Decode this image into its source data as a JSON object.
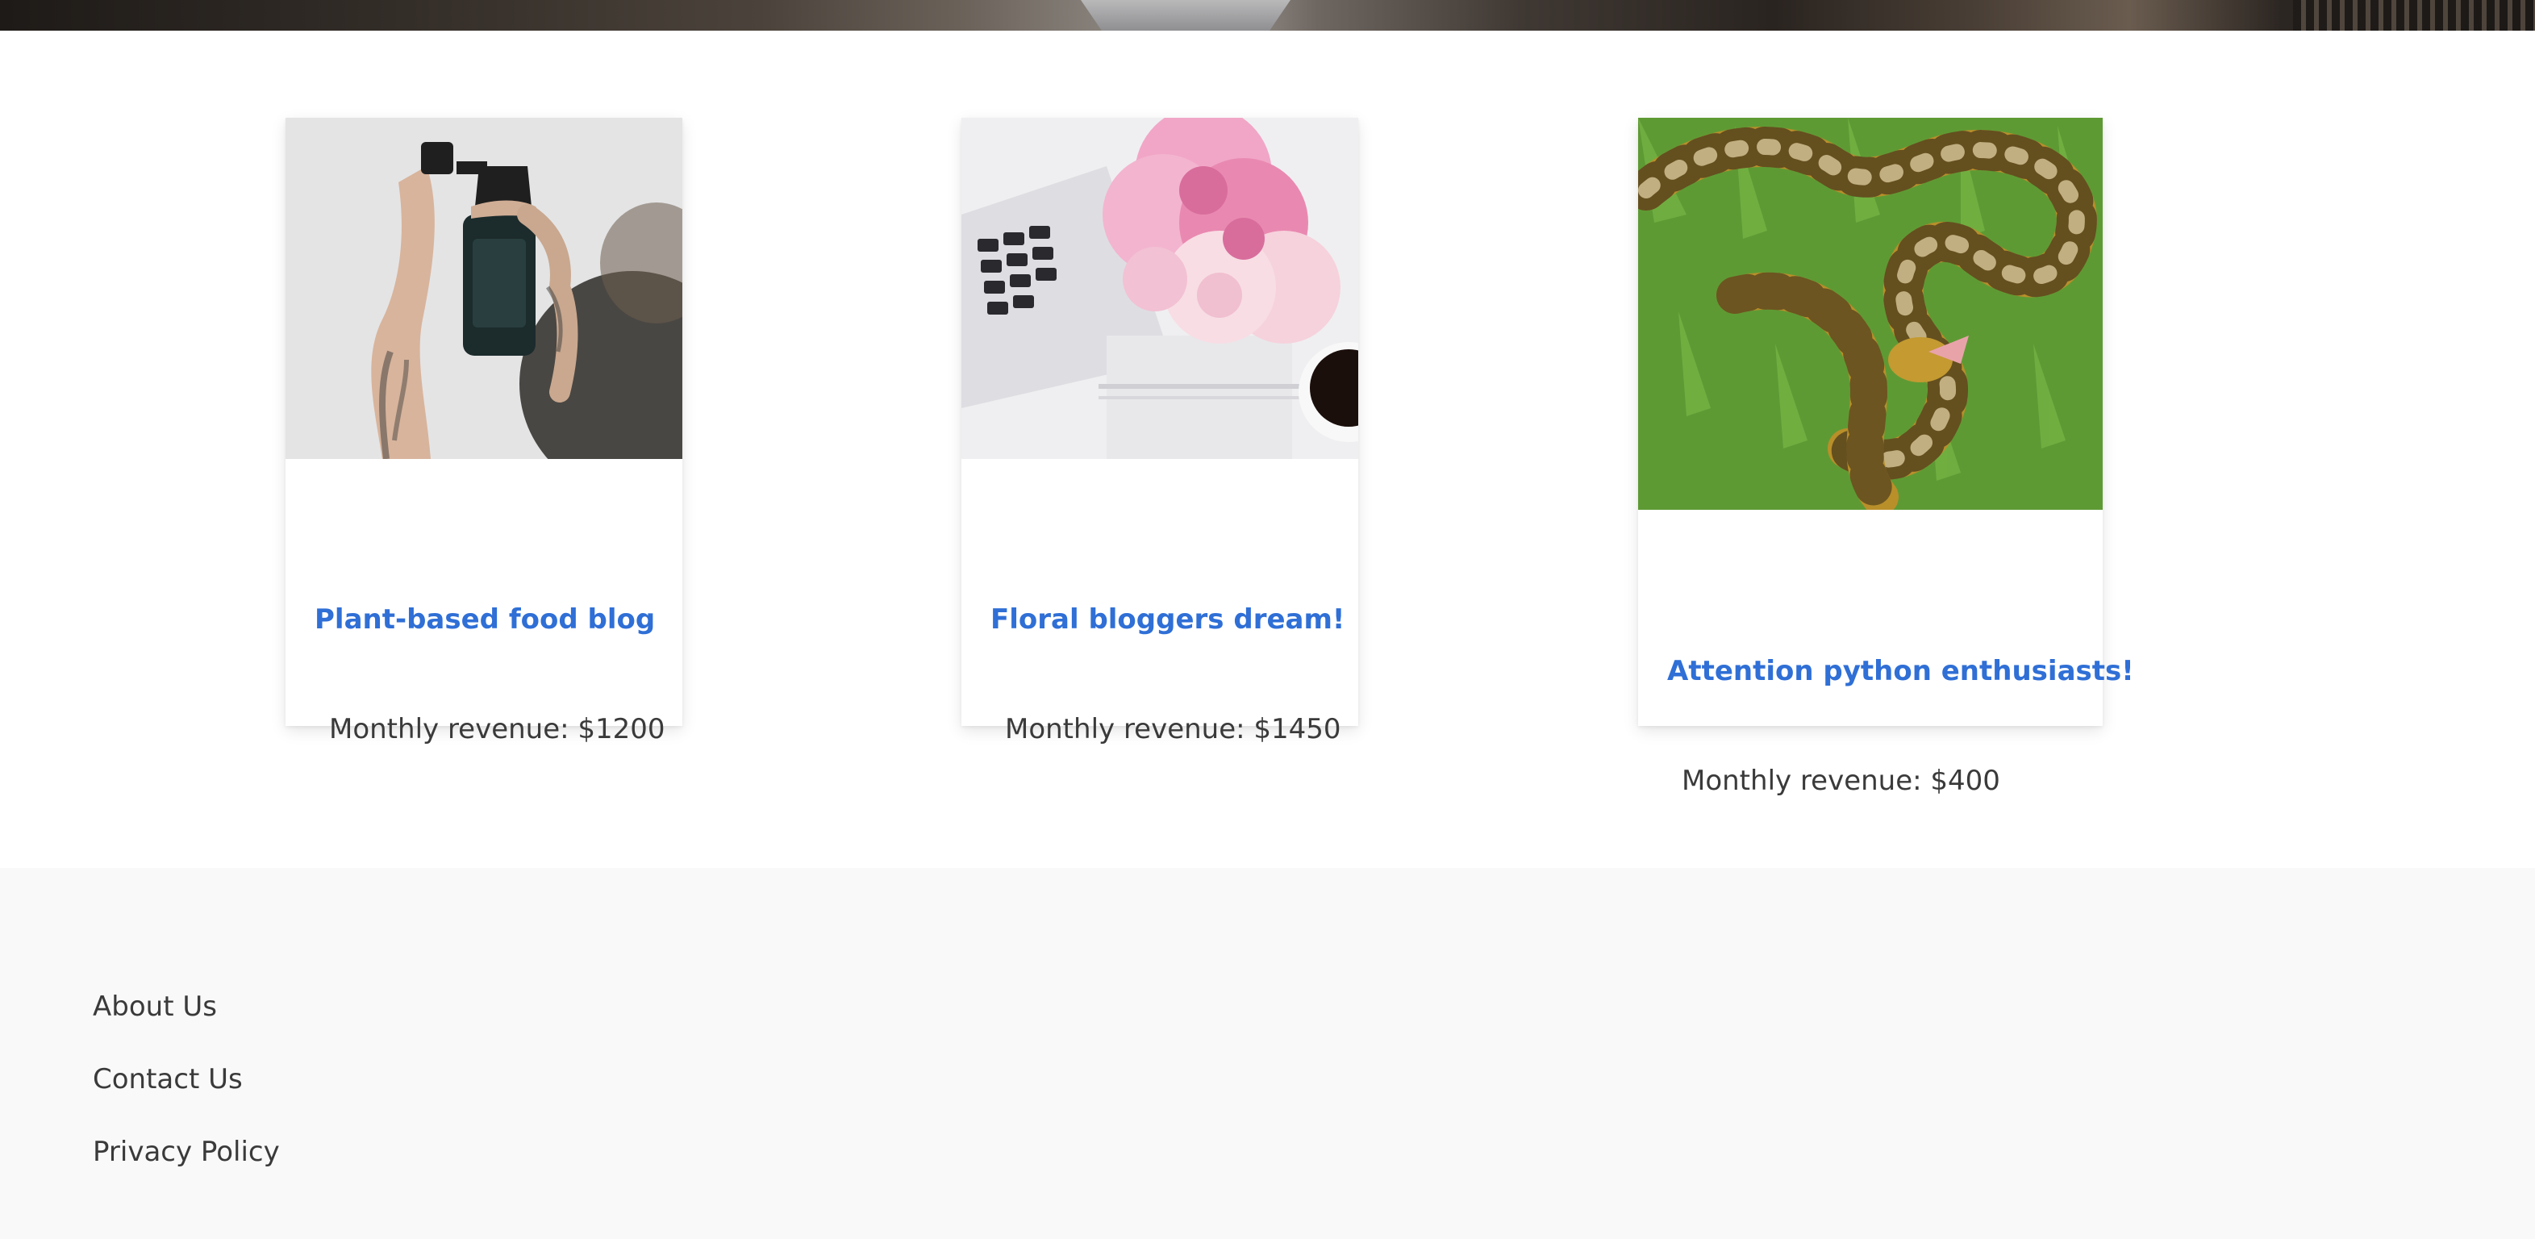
{
  "colors": {
    "link_blue": "#2f6fd6",
    "text": "#3a3a3a",
    "footer_bg": "#f9f9f9"
  },
  "listings": [
    {
      "title": "Plant-based food blog",
      "revenue": "Monthly revenue: $1200",
      "image_icon": "hand-spray-bottle-image"
    },
    {
      "title": "Floral bloggers dream!",
      "revenue": "Monthly revenue: $1450",
      "image_icon": "peonies-laptop-image"
    },
    {
      "title": "Attention python enthusiasts!",
      "revenue": "Monthly revenue: $400",
      "image_icon": "python-snake-image"
    }
  ],
  "footer": {
    "links": [
      "About Us",
      "Contact Us",
      "Privacy Policy"
    ]
  }
}
